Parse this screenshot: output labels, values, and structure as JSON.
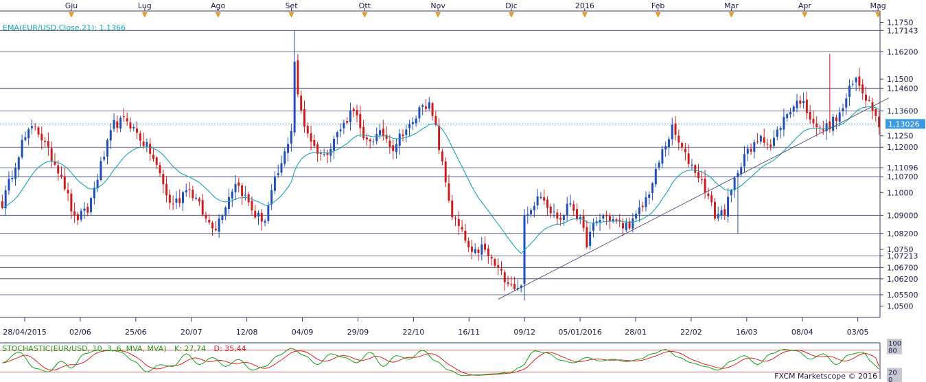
{
  "indicator_label": "EMA(EUR/USD.Close,21): 1,1366",
  "stochastic_label_name": "STOCHASTIC(EUR/USD, 10, 3, 6, MVA, MVA)",
  "stochastic_k_label": "K: 27,74",
  "stochastic_d_label": "D: 35,44",
  "watermark": "FXCM Marketscope © 2016",
  "colors": {
    "up": "#1f4fb5",
    "down": "#cc1c1c",
    "ema": "#1aa3b5",
    "current_price_bg": "#3b9ae1",
    "grid": "#3a3a6a",
    "stoch_k": "#1a9e1a",
    "stoch_d": "#e02020",
    "marker": "#f0a020"
  },
  "chart_data": [
    {
      "type": "candlestick",
      "instrument": "EUR/USD",
      "x_months": [
        "Giu",
        "Lug",
        "Ago",
        "Set",
        "Ott",
        "Nov",
        "Dic",
        "2016",
        "Feb",
        "Mar",
        "Apr",
        "Mag"
      ],
      "x_dates": [
        "28/04/2015",
        "02/06",
        "25/06",
        "20/07",
        "12/08",
        "04/09",
        "29/09",
        "22/10",
        "16/11",
        "09/12",
        "05/01/2016",
        "28/01",
        "22/02",
        "16/03",
        "08/04",
        "03/05"
      ],
      "y_ticks": [
        "1,1750",
        "1,1500",
        "1,1250",
        "1,1000",
        "1,0750",
        "1,0500"
      ],
      "level_labels": [
        "1,17143",
        "1,16200",
        "1,14600",
        "1,13600",
        "1,12000",
        "1,11096",
        "1,10700",
        "1,09000",
        "1,08200",
        "1,07213",
        "1,06700",
        "1,06200",
        "1,05500"
      ],
      "levels": [
        1.17143,
        1.162,
        1.146,
        1.136,
        1.12,
        1.11096,
        1.107,
        1.09,
        1.082,
        1.07213,
        1.067,
        1.062,
        1.055
      ],
      "current_price_label": "1,13026",
      "current_price": 1.13026,
      "ylim": [
        1.045,
        1.18
      ],
      "trendline": {
        "start": [
          "09/12",
          1.053
        ],
        "end": [
          "03/05",
          1.135
        ]
      },
      "close_anchors": [
        [
          0,
          1.095
        ],
        [
          6,
          1.122
        ],
        [
          10,
          1.13
        ],
        [
          14,
          1.118
        ],
        [
          18,
          1.108
        ],
        [
          22,
          1.088
        ],
        [
          26,
          1.092
        ],
        [
          30,
          1.112
        ],
        [
          34,
          1.13
        ],
        [
          38,
          1.132
        ],
        [
          42,
          1.124
        ],
        [
          45,
          1.118
        ],
        [
          48,
          1.108
        ],
        [
          51,
          1.095
        ],
        [
          54,
          1.097
        ],
        [
          56,
          1.103
        ],
        [
          59,
          1.097
        ],
        [
          62,
          1.088
        ],
        [
          65,
          1.085
        ],
        [
          68,
          1.095
        ],
        [
          71,
          1.105
        ],
        [
          74,
          1.098
        ],
        [
          77,
          1.09
        ],
        [
          80,
          1.088
        ],
        [
          83,
          1.105
        ],
        [
          85,
          1.112
        ],
        [
          88,
          1.128
        ],
        [
          89,
          1.158
        ],
        [
          90,
          1.142
        ],
        [
          92,
          1.13
        ],
        [
          95,
          1.12
        ],
        [
          98,
          1.116
        ],
        [
          101,
          1.124
        ],
        [
          104,
          1.13
        ],
        [
          107,
          1.138
        ],
        [
          110,
          1.122
        ],
        [
          113,
          1.124
        ],
        [
          116,
          1.126
        ],
        [
          119,
          1.12
        ],
        [
          122,
          1.127
        ],
        [
          125,
          1.13
        ],
        [
          128,
          1.14
        ],
        [
          130,
          1.138
        ],
        [
          132,
          1.128
        ],
        [
          134,
          1.112
        ],
        [
          137,
          1.09
        ],
        [
          140,
          1.082
        ],
        [
          143,
          1.072
        ],
        [
          146,
          1.076
        ],
        [
          149,
          1.07
        ],
        [
          152,
          1.064
        ],
        [
          155,
          1.06
        ],
        [
          157,
          1.057
        ],
        [
          158,
          1.061
        ],
        [
          159,
          1.088
        ],
        [
          161,
          1.092
        ],
        [
          163,
          1.1
        ],
        [
          165,
          1.098
        ],
        [
          167,
          1.092
        ],
        [
          170,
          1.088
        ],
        [
          173,
          1.096
        ],
        [
          176,
          1.087
        ],
        [
          178,
          1.078
        ],
        [
          180,
          1.085
        ],
        [
          183,
          1.09
        ],
        [
          186,
          1.088
        ],
        [
          189,
          1.085
        ],
        [
          192,
          1.087
        ],
        [
          195,
          1.094
        ],
        [
          198,
          1.104
        ],
        [
          201,
          1.118
        ],
        [
          204,
          1.128
        ],
        [
          206,
          1.122
        ],
        [
          208,
          1.116
        ],
        [
          211,
          1.11
        ],
        [
          214,
          1.102
        ],
        [
          217,
          1.09
        ],
        [
          220,
          1.092
        ],
        [
          222,
          1.1
        ],
        [
          224,
          1.11
        ],
        [
          226,
          1.117
        ],
        [
          228,
          1.118
        ],
        [
          231,
          1.126
        ],
        [
          234,
          1.12
        ],
        [
          237,
          1.13
        ],
        [
          240,
          1.137
        ],
        [
          243,
          1.141
        ],
        [
          246,
          1.134
        ],
        [
          249,
          1.127
        ],
        [
          252,
          1.13
        ],
        [
          255,
          1.134
        ],
        [
          258,
          1.145
        ],
        [
          260,
          1.15
        ],
        [
          262,
          1.145
        ],
        [
          264,
          1.14
        ],
        [
          266,
          1.136
        ],
        [
          267,
          1.13
        ]
      ],
      "ema_period": 21
    },
    {
      "type": "line",
      "title": "STOCHASTIC(EUR/USD, 10, 3, 6, MVA, MVA)",
      "ylim": [
        0,
        100
      ],
      "y_ticks": [
        "100",
        "80",
        "20",
        "0"
      ],
      "reference_levels": [
        80,
        20
      ],
      "series": [
        {
          "name": "K",
          "last": 27.74
        },
        {
          "name": "D",
          "last": 35.44
        }
      ],
      "k_anchors": [
        [
          0,
          45
        ],
        [
          5,
          75
        ],
        [
          10,
          30
        ],
        [
          14,
          20
        ],
        [
          18,
          50
        ],
        [
          21,
          30
        ],
        [
          25,
          70
        ],
        [
          29,
          80
        ],
        [
          33,
          80
        ],
        [
          36,
          75
        ],
        [
          40,
          50
        ],
        [
          44,
          20
        ],
        [
          48,
          40
        ],
        [
          52,
          35
        ],
        [
          56,
          70
        ],
        [
          60,
          40
        ],
        [
          64,
          60
        ],
        [
          68,
          35
        ],
        [
          72,
          55
        ],
        [
          76,
          25
        ],
        [
          80,
          35
        ],
        [
          84,
          65
        ],
        [
          88,
          85
        ],
        [
          92,
          65
        ],
        [
          96,
          40
        ],
        [
          100,
          70
        ],
        [
          104,
          60
        ],
        [
          108,
          45
        ],
        [
          112,
          75
        ],
        [
          116,
          35
        ],
        [
          120,
          65
        ],
        [
          124,
          55
        ],
        [
          128,
          80
        ],
        [
          132,
          50
        ],
        [
          136,
          25
        ],
        [
          140,
          10
        ],
        [
          145,
          12
        ],
        [
          150,
          15
        ],
        [
          155,
          20
        ],
        [
          158,
          35
        ],
        [
          162,
          78
        ],
        [
          166,
          72
        ],
        [
          170,
          52
        ],
        [
          174,
          45
        ],
        [
          178,
          60
        ],
        [
          182,
          50
        ],
        [
          186,
          55
        ],
        [
          190,
          48
        ],
        [
          194,
          55
        ],
        [
          198,
          70
        ],
        [
          202,
          82
        ],
        [
          206,
          60
        ],
        [
          210,
          45
        ],
        [
          214,
          35
        ],
        [
          218,
          25
        ],
        [
          222,
          50
        ],
        [
          226,
          65
        ],
        [
          230,
          40
        ],
        [
          234,
          70
        ],
        [
          238,
          82
        ],
        [
          242,
          78
        ],
        [
          246,
          55
        ],
        [
          250,
          70
        ],
        [
          254,
          40
        ],
        [
          258,
          68
        ],
        [
          262,
          75
        ],
        [
          265,
          45
        ],
        [
          267,
          28
        ]
      ]
    }
  ]
}
